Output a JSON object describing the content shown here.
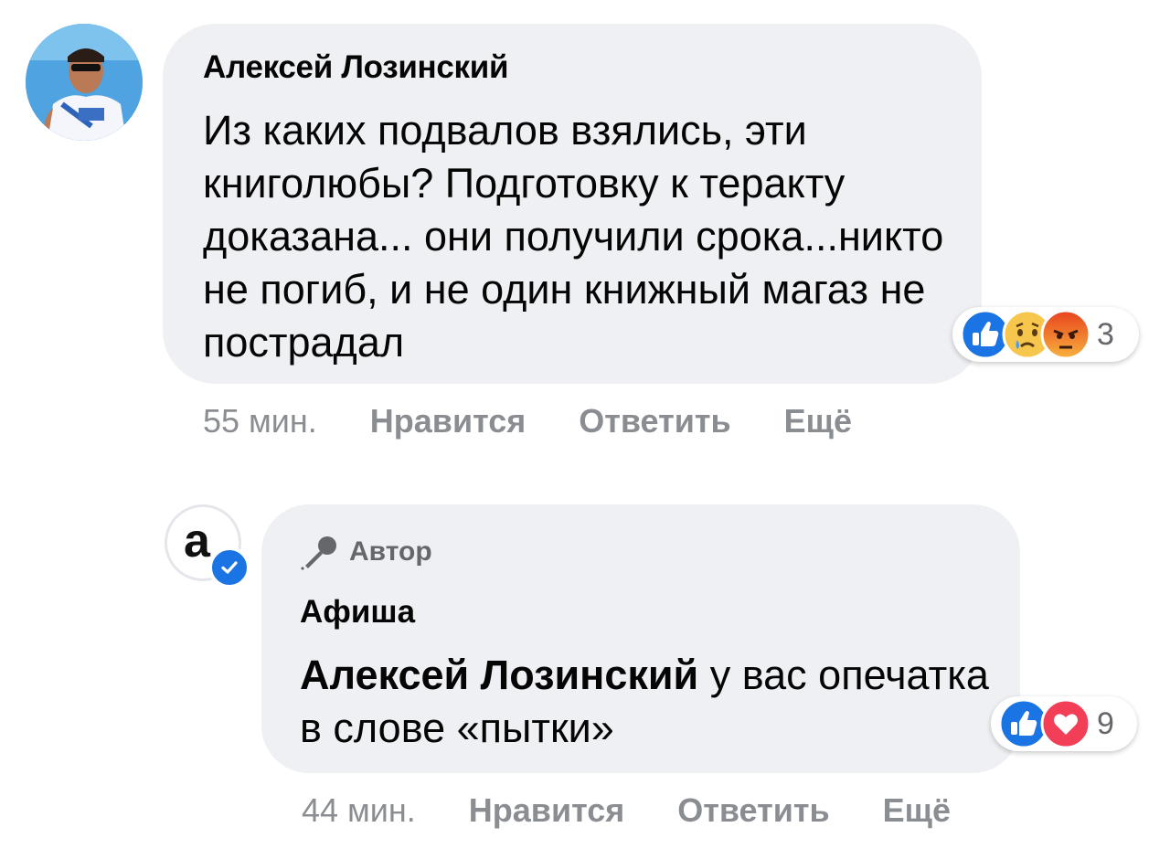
{
  "comments": [
    {
      "author": "Алексей Лозинский",
      "text": "Из каких подвалов взялись, эти книголюбы? Подготовку к теракту доказана... они получили срока...никто не погиб, и не один книжный магаз не пострадал",
      "reactions": {
        "icons": [
          "like-icon",
          "sad-icon",
          "angry-icon"
        ],
        "count": "3"
      },
      "time": "55 мин.",
      "actions": {
        "like": "Нравится",
        "reply": "Ответить",
        "more": "Ещё"
      }
    },
    {
      "badge": "Автор",
      "author": "Афиша",
      "avatar_letter": "а",
      "mention": "Алексей Лозинский",
      "text": " у вас опечатка в слове «пытки»",
      "reactions": {
        "icons": [
          "like-icon",
          "love-icon"
        ],
        "count": "9"
      },
      "time": "44 мин.",
      "actions": {
        "like": "Нравится",
        "reply": "Ответить",
        "more": "Ещё"
      }
    }
  ],
  "colors": {
    "bubble": "#eff0f3",
    "meta_text": "#8a8d91",
    "like_blue": "#1b74e4",
    "love_red": "#f33e58",
    "angry_orange": "#e9710f",
    "verified_blue": "#1b74e4"
  }
}
